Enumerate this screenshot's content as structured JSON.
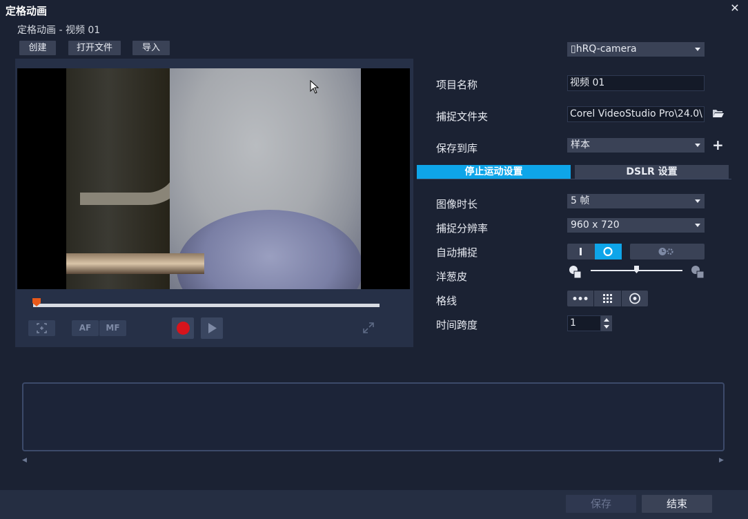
{
  "window": {
    "title": "定格动画",
    "close_icon": "close-icon"
  },
  "project_subtitle": "定格动画 - 视频 01",
  "toolbar": {
    "create": "创建",
    "open_file": "打开文件",
    "import": "导入"
  },
  "preview": {
    "af_label": "AF",
    "mf_label": "MF",
    "scrub_position": 0.0
  },
  "settings": {
    "camera": "▯hRQ-camera",
    "project_name_label": "项目名称",
    "project_name_value": "视频 01",
    "capture_folder_label": "捕捉文件夹",
    "capture_folder_value": "Corel VideoStudio Pro\\24.0\\",
    "save_to_library_label": "保存到库",
    "save_to_library_value": "样本"
  },
  "tabs": {
    "stop_motion": "停止运动设置",
    "dslr": "DSLR 设置",
    "active": "stop_motion"
  },
  "motion": {
    "image_duration_label": "图像时长",
    "image_duration_value": "5 帧",
    "capture_resolution_label": "捕捉分辨率",
    "capture_resolution_value": "960 x 720",
    "auto_capture_label": "自动捕捉",
    "onion_skin_label": "洋葱皮",
    "onion_skin_level": 0.5,
    "gridlines_label": "格线",
    "time_span_label": "时间跨度",
    "time_span_value": "1"
  },
  "footer": {
    "save": "保存",
    "finish": "结束"
  },
  "colors": {
    "accent": "#0ea5e9",
    "record": "#d7141c",
    "scrubber_head": "#e8591a"
  }
}
